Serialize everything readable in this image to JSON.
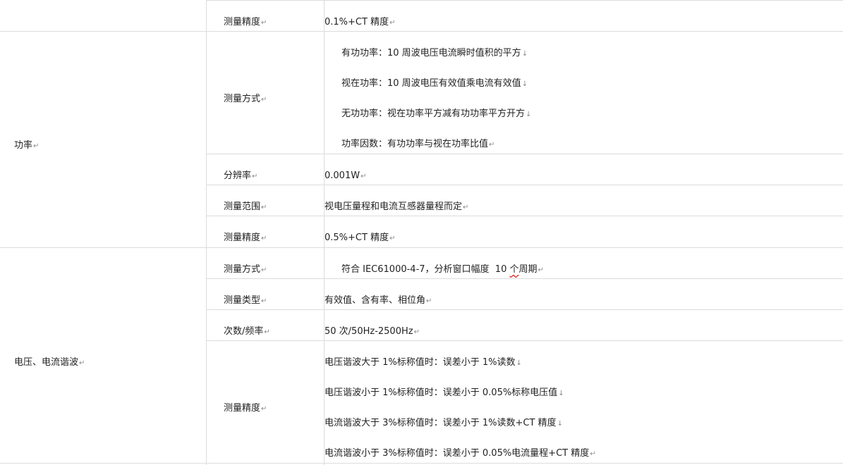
{
  "rows": {
    "r0_label": "测量精度",
    "r0_value": "0.1%+CT 精度",
    "group1": "功率",
    "r1_label": "测量方式",
    "r1_lines": [
      "有功功率：10 周波电压电流瞬时值积的平方",
      "视在功率：10 周波电压有效值乘电流有效值",
      "无功功率：视在功率平方减有功功率平方开方",
      "功率因数：有功功率与视在功率比值"
    ],
    "r2_label": "分辨率",
    "r2_value": "0.001W",
    "r3_label": "测量范围",
    "r3_value": "视电压量程和电流互感器量程而定",
    "r4_label": "测量精度",
    "r4_value": "0.5%+CT 精度",
    "group2": "电压、电流谐波",
    "r5_label": "测量方式",
    "r5_value_a": "符合 IEC61000-4-7，分析窗口幅度  10 ",
    "r5_value_b": "个",
    "r5_value_c": "周期",
    "r6_label": "测量类型",
    "r6_value": "有效值、含有率、相位角",
    "r7_label": "次数/频率",
    "r7_value": "50 次/50Hz-2500Hz",
    "r8_label": "测量精度",
    "r8_lines": [
      "电压谐波大于 1%标称值时：误差小于 1%读数",
      "电压谐波小于 1%标称值时：误差小于 0.05%标称电压值",
      "电流谐波大于 3%标称值时：误差小于 1%读数+CT 精度",
      "电流谐波小于 3%标称值时：误差小于 0.05%电流量程+CT 精度"
    ]
  },
  "marks": {
    "para": "↵",
    "line": "↓"
  }
}
